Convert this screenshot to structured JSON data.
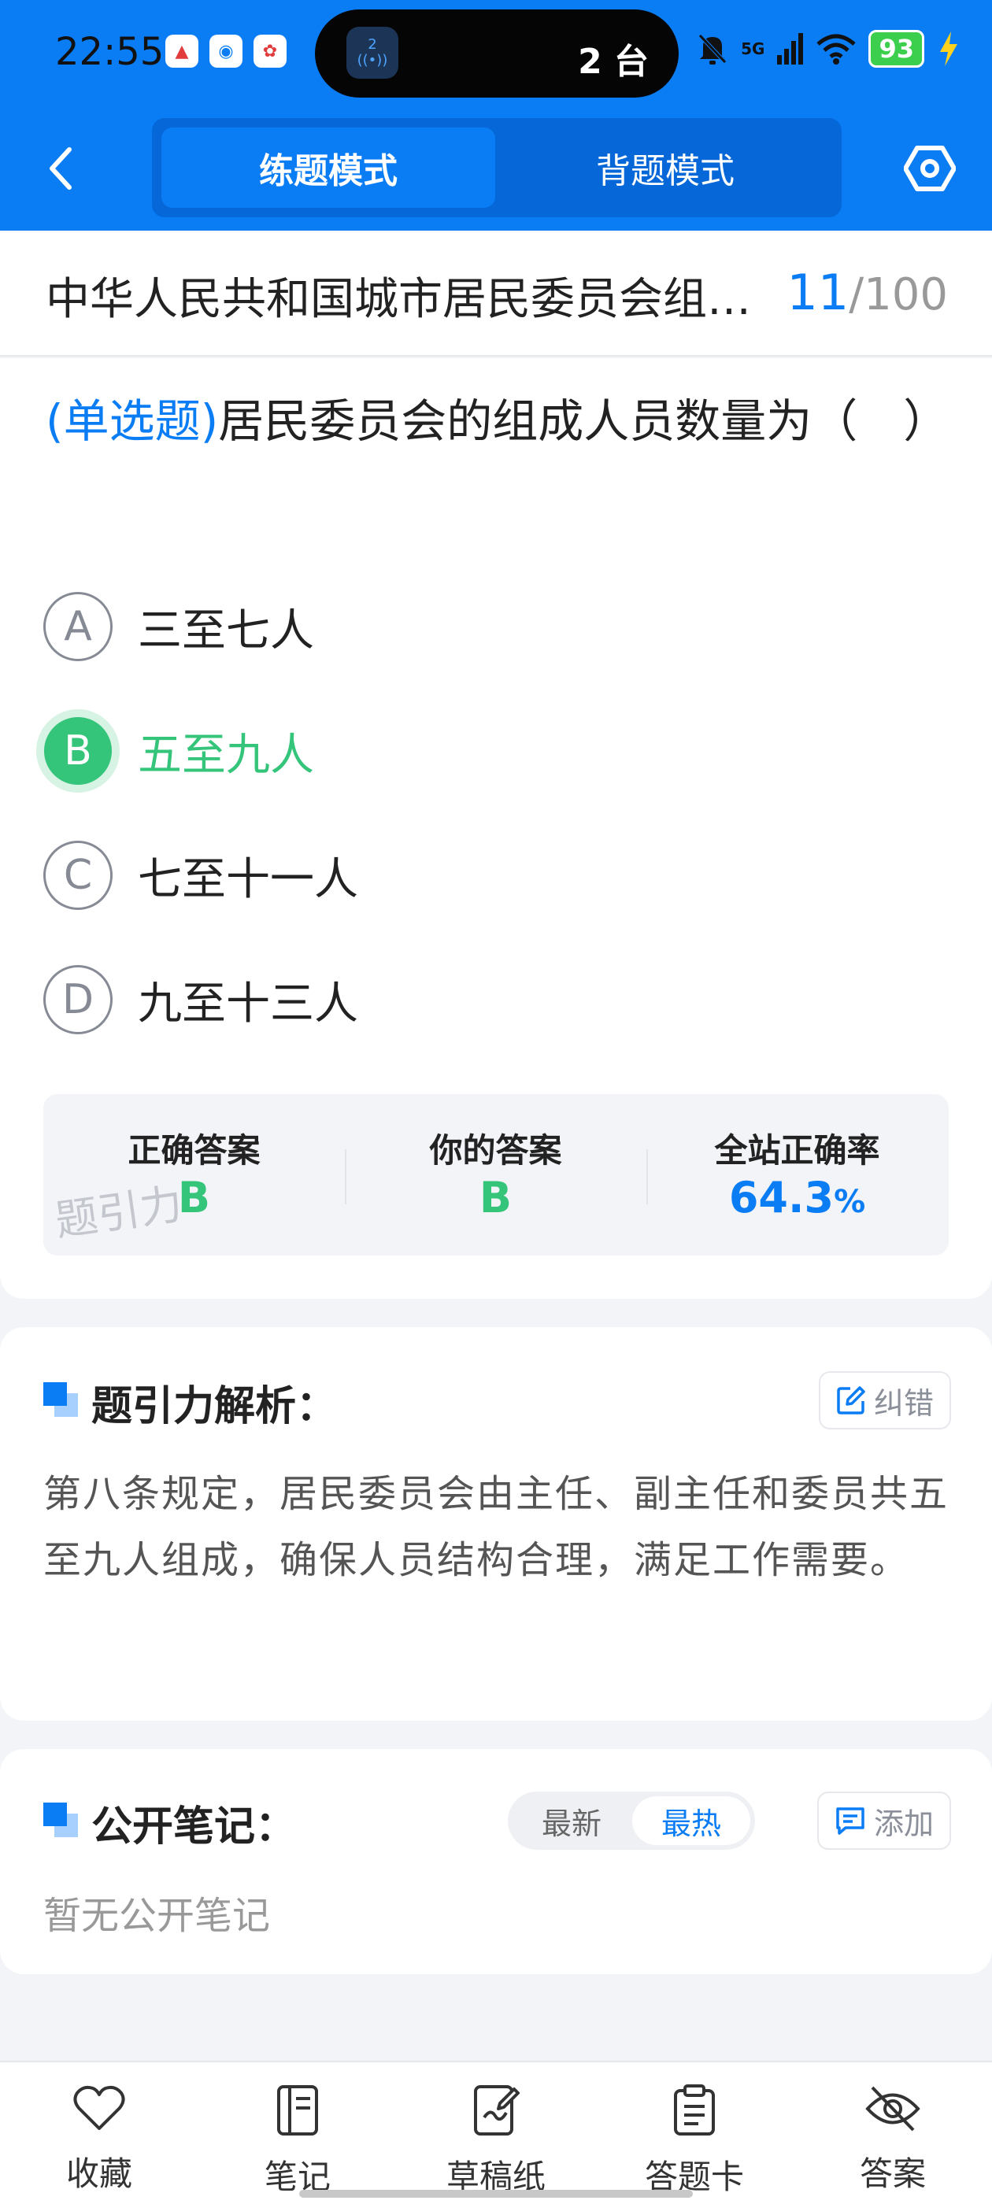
{
  "status_bar": {
    "time": "22:55",
    "pill_badge": "2",
    "pill_text": "2 台",
    "network": "5G",
    "battery": "93"
  },
  "header": {
    "tabs": [
      {
        "label": "练题模式",
        "active": true
      },
      {
        "label": "背题模式",
        "active": false
      }
    ]
  },
  "title_bar": {
    "title": "中华人民共和国城市居民委员会组织法",
    "current": "11",
    "total": "/100"
  },
  "question": {
    "type": "(单选题)",
    "text": "居民委员会的组成人员数量为（　）",
    "options": [
      {
        "letter": "A",
        "text": "三至七人",
        "selected": false
      },
      {
        "letter": "B",
        "text": "五至九人",
        "selected": true
      },
      {
        "letter": "C",
        "text": "七至十一人",
        "selected": false
      },
      {
        "letter": "D",
        "text": "九至十三人",
        "selected": false
      }
    ]
  },
  "stats": {
    "correct_label": "正确答案",
    "correct_value": "B",
    "yours_label": "你的答案",
    "yours_value": "B",
    "rate_label": "全站正确率",
    "rate_value": "64.3",
    "rate_unit": "%",
    "watermark": "题引力"
  },
  "analysis": {
    "title": "题引力解析：",
    "correct_button": "纠错",
    "text": "第八条规定，居民委员会由主任、副主任和委员共五至九人组成，确保人员结构合理，满足工作需要。"
  },
  "notes": {
    "title": "公开笔记：",
    "sort_latest": "最新",
    "sort_hot": "最热",
    "add_button": "添加",
    "empty": "暂无公开笔记"
  },
  "bottom_nav": [
    {
      "label": "收藏",
      "icon": "heart-icon"
    },
    {
      "label": "笔记",
      "icon": "notebook-icon"
    },
    {
      "label": "草稿纸",
      "icon": "draft-icon"
    },
    {
      "label": "答题卡",
      "icon": "answer-sheet-icon"
    },
    {
      "label": "答案",
      "icon": "eye-off-icon"
    }
  ],
  "colors": {
    "primary": "#0a7df5",
    "correct": "#34c47a"
  }
}
